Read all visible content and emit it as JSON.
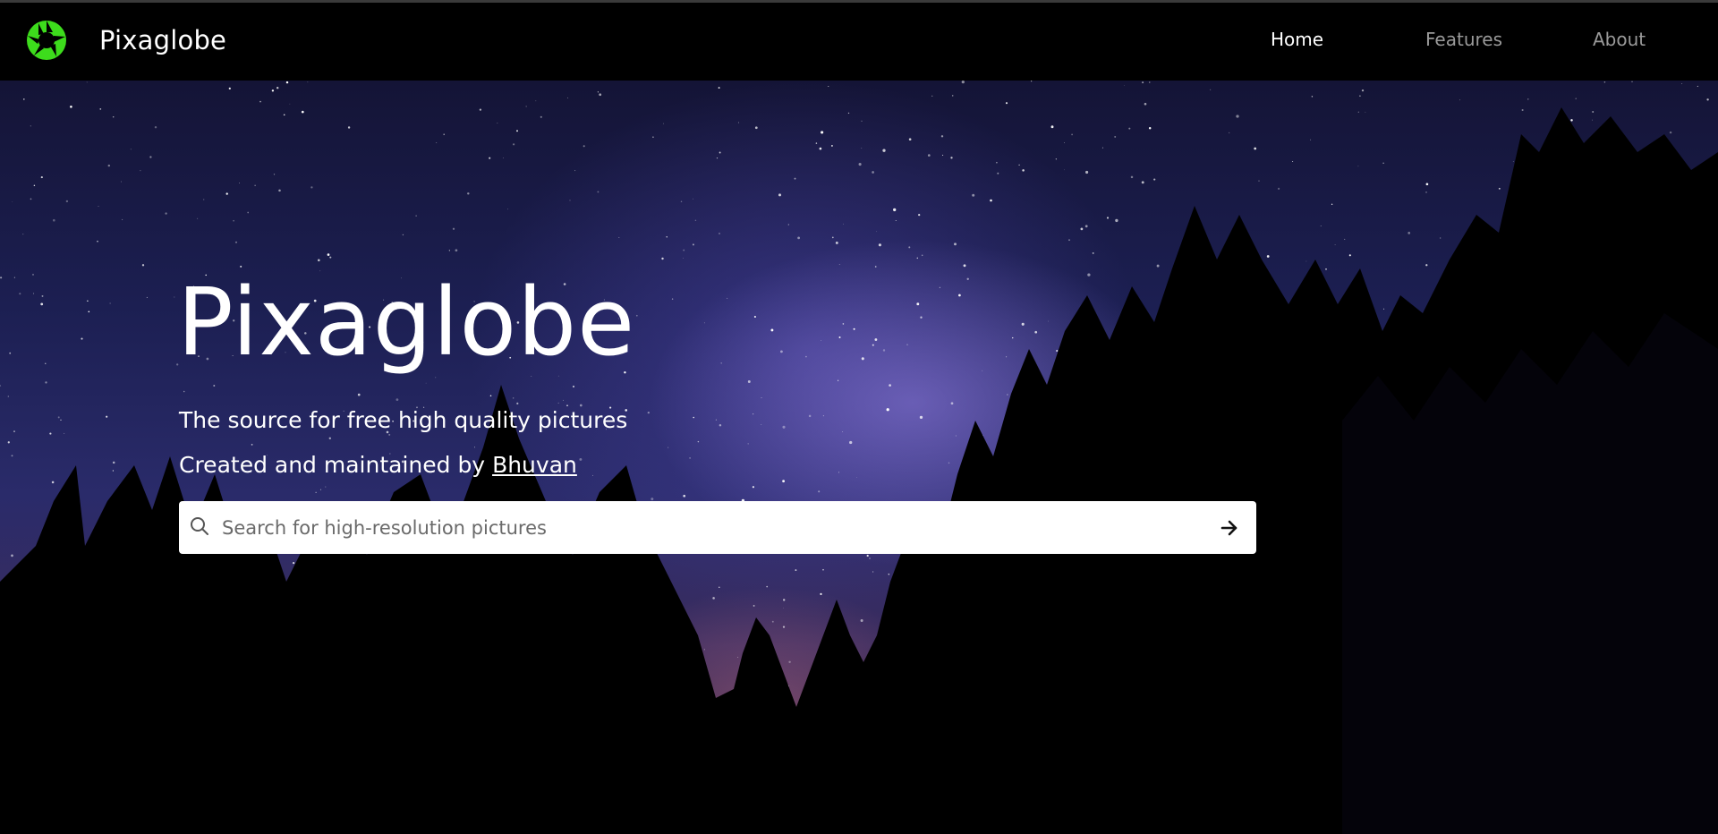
{
  "navbar": {
    "brand_name": "Pixaglobe",
    "logo_color": "#3ddc1c",
    "links": [
      {
        "label": "Home",
        "active": true
      },
      {
        "label": "Features",
        "active": false
      },
      {
        "label": "About",
        "active": false
      }
    ]
  },
  "hero": {
    "title": "Pixaglobe",
    "tagline": "The source for free high quality pictures",
    "credit_prefix": "Created and maintained by ",
    "credit_link": "Bhuvan"
  },
  "search": {
    "placeholder": "Search for high-resolution pictures",
    "value": ""
  },
  "icons": {
    "logo": "camera-shutter-icon",
    "search": "search-icon",
    "submit": "arrow-right-icon"
  },
  "colors": {
    "nav_background": "#000000",
    "nav_active": "#ffffff",
    "nav_inactive": "#9a9a9a",
    "search_background": "#ffffff"
  }
}
